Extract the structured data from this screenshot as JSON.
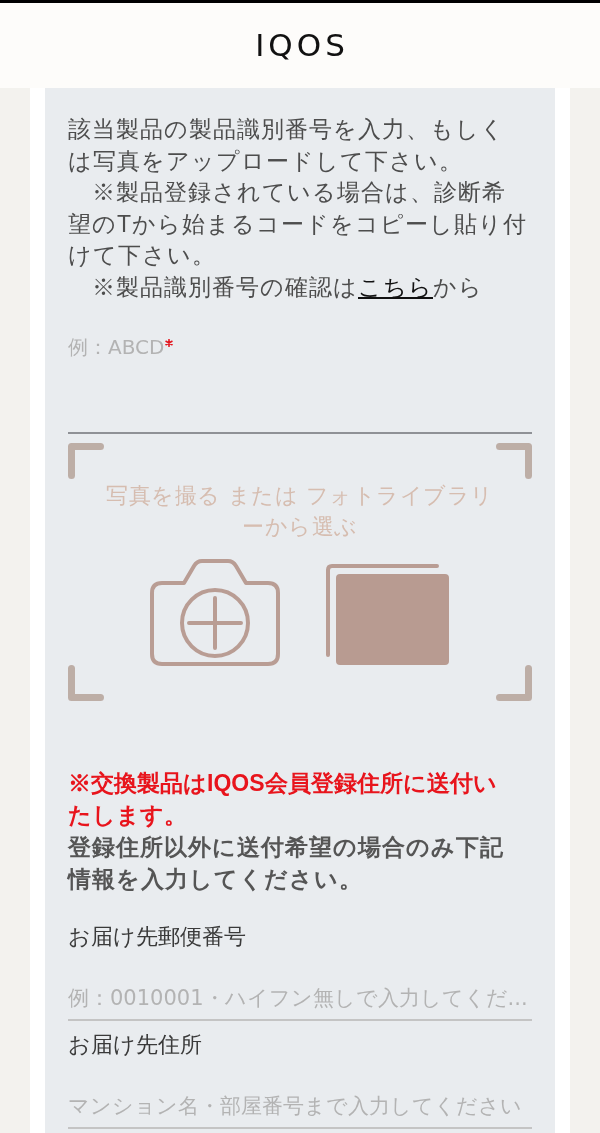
{
  "header": {
    "logo": "IQOS"
  },
  "instructions": [
    {
      "text": "該当製品の製品識別番号を入力、もしくは写真をアップロードして下さい。"
    },
    {
      "text": "　※製品登録されている場合は、診断希望のTから始まるコードをコピーし貼り付けて下さい。"
    },
    {
      "text": "　※製品識別番号の確認は",
      "link": "こちら",
      "after": "から"
    }
  ],
  "product_code_field": {
    "placeholder": "例：ABCD",
    "required": true
  },
  "upload": {
    "prompt": "写真を撮る または フォトライブラリーから選ぶ"
  },
  "notice": {
    "warning": "※交換製品はIQOS会員登録住所に送付いたします。",
    "note": "登録住所以外に送付希望の場合のみ下記情報を入力してください。"
  },
  "delivery_fields": [
    {
      "label": "お届け先郵便番号",
      "placeholder": "例：0010001・ハイフン無しで入力してくだ..."
    },
    {
      "label": "お届け先住所",
      "placeholder": "マンション名・部屋番号まで入力してください"
    }
  ]
}
